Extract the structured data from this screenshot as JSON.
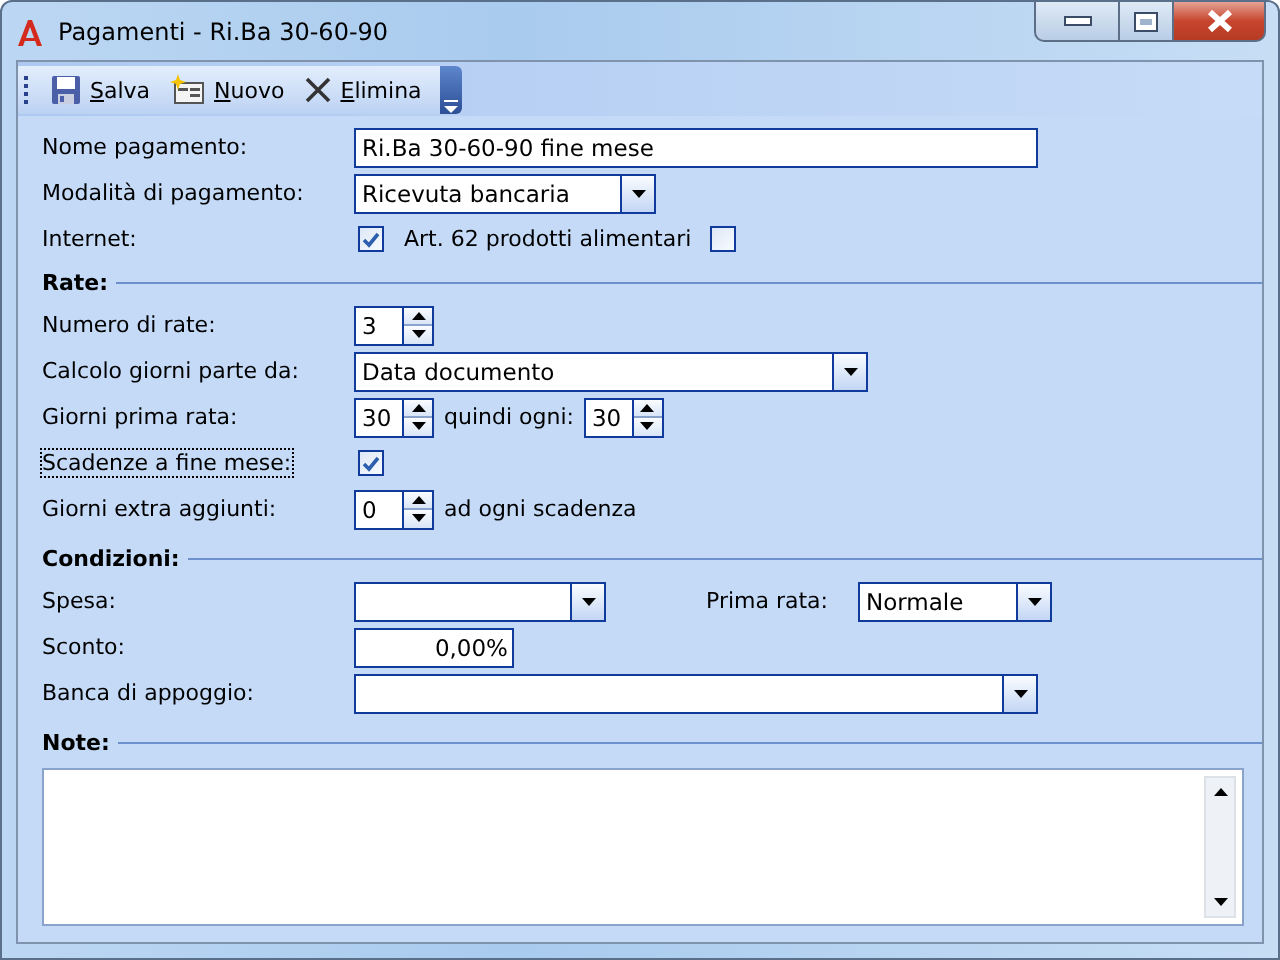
{
  "window": {
    "title": "Pagamenti - Ri.Ba 30-60-90"
  },
  "toolbar": {
    "buttons": [
      {
        "kind": "save",
        "label": "Salva"
      },
      {
        "kind": "new",
        "label": "Nuovo"
      },
      {
        "kind": "delete",
        "label": "Elimina"
      }
    ]
  },
  "general": {
    "rows": [
      {
        "label": "Nome pagamento:",
        "focused": false,
        "controls": [
          {
            "kind": "text",
            "value": "Ri.Ba 30-60-90 fine mese"
          }
        ]
      },
      {
        "label": "Modalità di pagamento:",
        "focused": false,
        "controls": [
          {
            "kind": "combo",
            "value": "Ricevuta bancaria"
          }
        ]
      },
      {
        "label": "Internet:",
        "focused": false,
        "controls": [
          {
            "kind": "check",
            "checked": true
          },
          {
            "kind": "caption",
            "text": "Art. 62 prodotti alimentari"
          },
          {
            "kind": "check",
            "checked": false
          }
        ]
      }
    ]
  },
  "sections": [
    {
      "title": "Rate:",
      "rows": [
        {
          "label": "Numero di rate:",
          "focused": false,
          "controls": [
            {
              "kind": "spin",
              "value": "3"
            }
          ]
        },
        {
          "label": "Calcolo giorni parte da:",
          "focused": false,
          "controls": [
            {
              "kind": "combo",
              "value": "Data documento"
            }
          ]
        },
        {
          "label": "Giorni prima rata:",
          "focused": false,
          "controls": [
            {
              "kind": "spin",
              "value": "30"
            },
            {
              "kind": "caption",
              "text": "quindi ogni:"
            },
            {
              "kind": "spin",
              "value": "30"
            }
          ]
        },
        {
          "label": "Scadenze a fine mese:",
          "focused": true,
          "controls": [
            {
              "kind": "check",
              "checked": true
            }
          ]
        },
        {
          "label": "Giorni extra aggiunti:",
          "focused": false,
          "controls": [
            {
              "kind": "spin",
              "value": "0"
            },
            {
              "kind": "caption",
              "text": "ad ogni scadenza"
            }
          ]
        }
      ]
    },
    {
      "title": "Condizioni:",
      "rows": [
        {
          "label": "Spesa:",
          "focused": false,
          "controls": [
            {
              "kind": "combo"
            },
            {
              "kind": "caption",
              "text": "Prima rata:"
            },
            {
              "kind": "combo",
              "value": "Normale"
            }
          ]
        },
        {
          "label": "Sconto:",
          "focused": false,
          "controls": [
            {
              "kind": "number",
              "value": "0,00%"
            }
          ]
        },
        {
          "label": "Banca di appoggio:",
          "focused": false,
          "controls": [
            {
              "kind": "combo"
            }
          ]
        }
      ]
    }
  ],
  "notes": {
    "title": "Note:"
  }
}
